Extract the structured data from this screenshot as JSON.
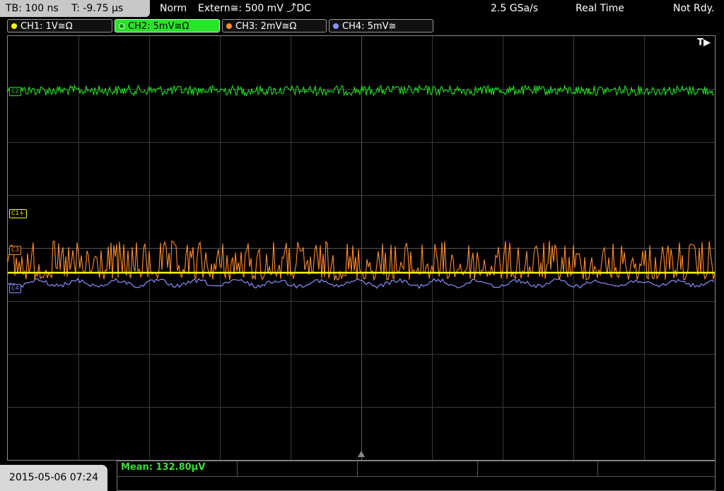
{
  "header": {
    "timebase": "TB: 100 ns",
    "trigger_time": "T: -9.75 µs",
    "mode": "Norm",
    "trigger_source": "Extern≅: 500 mV ⤴DC",
    "sample_rate": "2.5 GSa/s",
    "acquisition": "Real Time",
    "status": "Not Rdy."
  },
  "channels": [
    {
      "label": "CH1: 1V≅Ω",
      "color": "#ffff00",
      "active": false
    },
    {
      "label": "CH2: 5mV≅Ω",
      "color": "#22dd22",
      "active": true
    },
    {
      "label": "CH3: 2mV≅Ω",
      "color": "#ff8c2a",
      "active": false
    },
    {
      "label": "CH4: 5mV≅",
      "color": "#8c8cff",
      "active": false
    }
  ],
  "screen": {
    "trigger_flag": "T▶",
    "markers": {
      "c1": "C1⏚",
      "c2": "C2",
      "c3": "C3",
      "c4": "C4"
    }
  },
  "footer": {
    "datetime": "2015-05-06 07:24",
    "measurement": "Mean: 132.80µV"
  }
}
